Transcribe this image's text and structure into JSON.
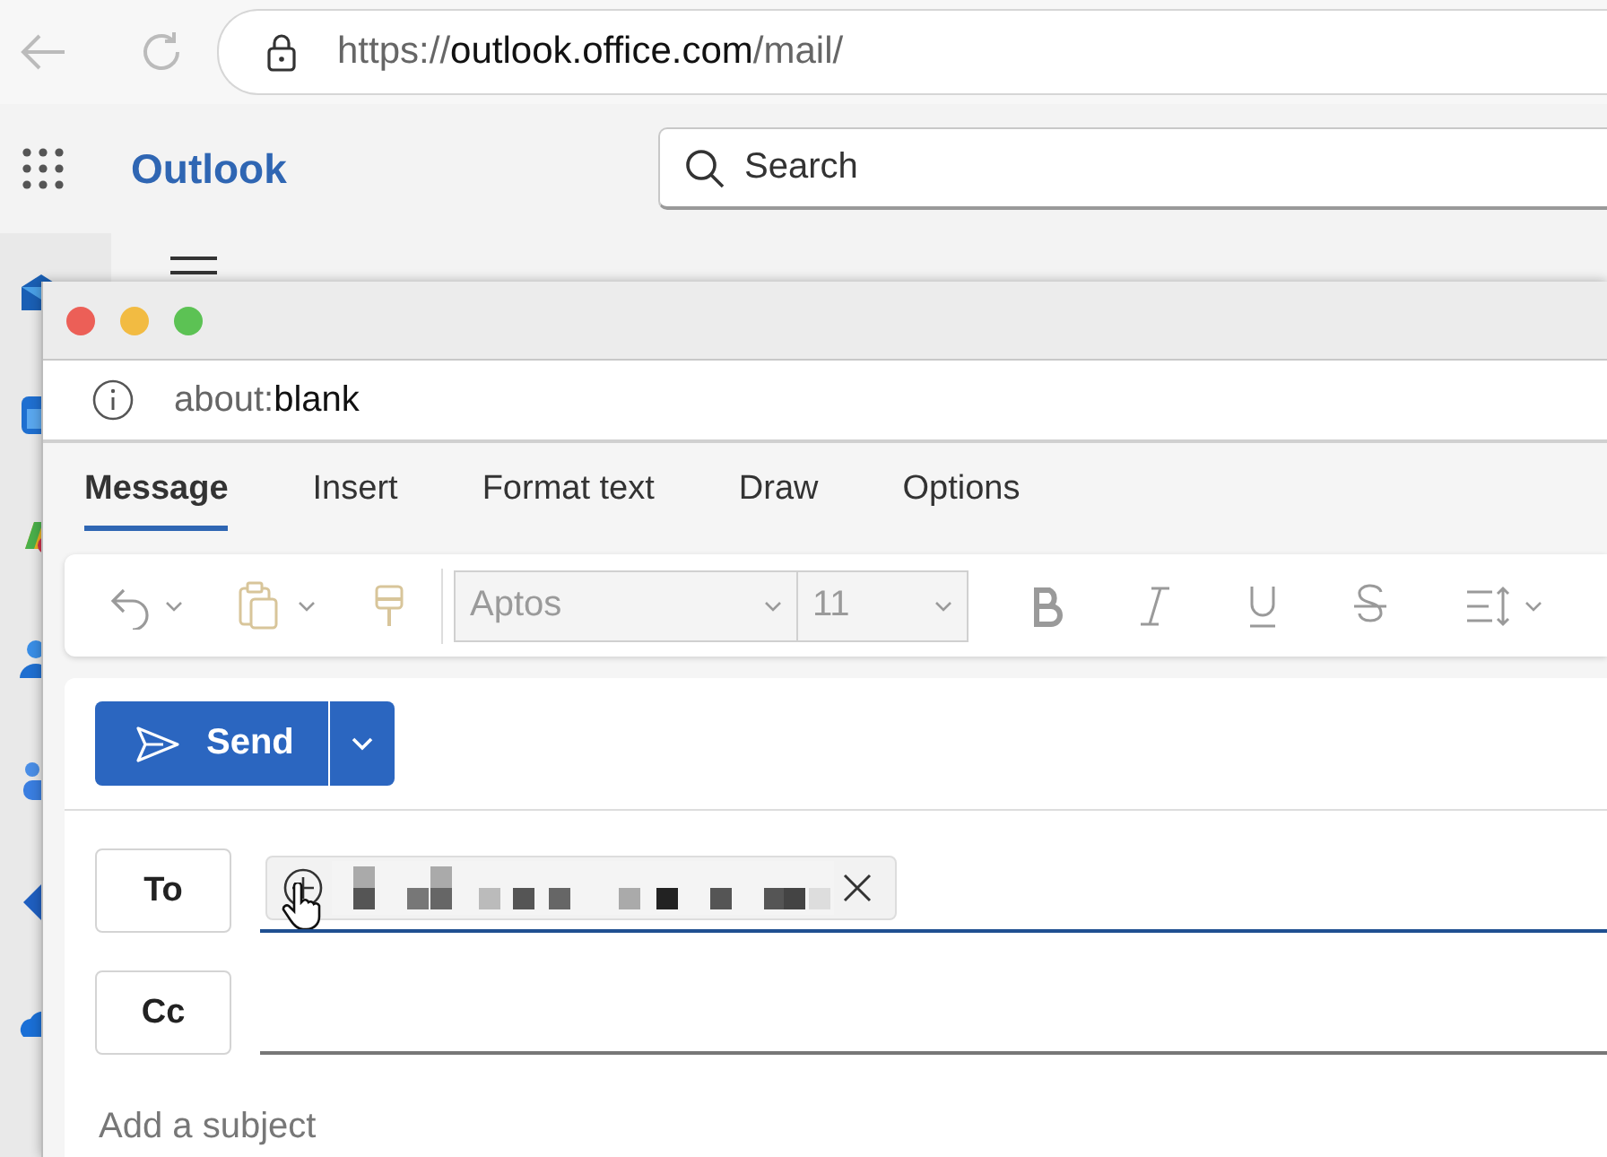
{
  "browser": {
    "url": {
      "scheme": "https://",
      "host": "outlook.office.com",
      "path": "/mail/"
    }
  },
  "app": {
    "name": "Outlook",
    "search": {
      "placeholder": "Search"
    }
  },
  "popup": {
    "address": {
      "scheme": "about:",
      "page": "blank"
    },
    "tabs": [
      {
        "label": "Message",
        "selected": true
      },
      {
        "label": "Insert",
        "selected": false
      },
      {
        "label": "Format text",
        "selected": false
      },
      {
        "label": "Draw",
        "selected": false
      },
      {
        "label": "Options",
        "selected": false
      }
    ],
    "toolbar": {
      "disabled": true,
      "font": "Aptos",
      "size": "11"
    },
    "send": {
      "label": "Send"
    },
    "fields": [
      {
        "label": "To",
        "focused": true,
        "has_recipient": true
      },
      {
        "label": "Cc",
        "focused": false,
        "has_recipient": false
      }
    ],
    "subject": {
      "placeholder": "Add a subject"
    }
  }
}
